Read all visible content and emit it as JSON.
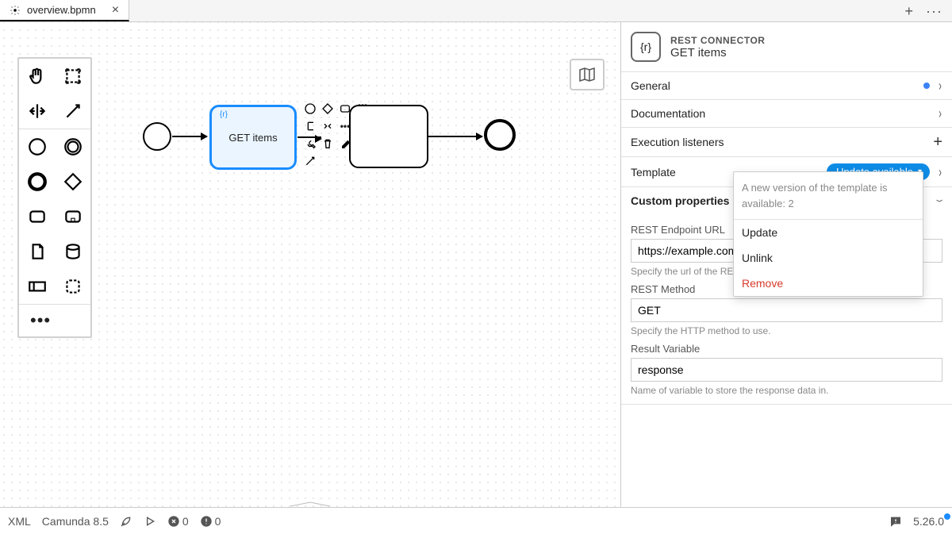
{
  "tab": {
    "filename": "overview.bpmn"
  },
  "panel": {
    "type_label": "REST CONNECTOR",
    "element_name": "GET items",
    "groups": {
      "general": {
        "title": "General"
      },
      "documentation": {
        "title": "Documentation"
      },
      "execution_listeners": {
        "title": "Execution listeners"
      },
      "template": {
        "title": "Template",
        "badge": "Update available"
      },
      "custom": {
        "title": "Custom properties"
      }
    },
    "fields": {
      "endpoint": {
        "label": "REST Endpoint URL",
        "value": "https://example.com",
        "help": "Specify the url of the REST endpoint."
      },
      "method": {
        "label": "REST Method",
        "value": "GET",
        "help": "Specify the HTTP method to use."
      },
      "result": {
        "label": "Result Variable",
        "value": "response",
        "help": "Name of variable to store the response data in."
      }
    },
    "template_dropdown": {
      "info": "A new version of the template is available: 2",
      "update": "Update",
      "unlink": "Unlink",
      "remove": "Remove"
    }
  },
  "canvas": {
    "task1_label": "GET items"
  },
  "status": {
    "xml": "XML",
    "engine": "Camunda 8.5",
    "errors": "0",
    "warnings": "0",
    "version": "5.26.0"
  }
}
